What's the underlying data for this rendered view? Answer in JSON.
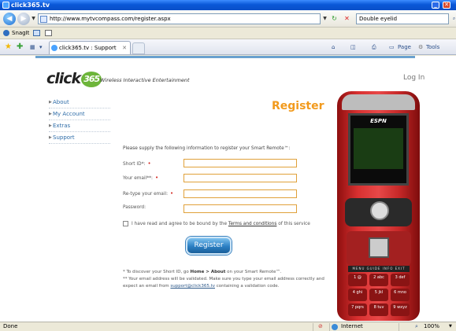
{
  "window": {
    "title": "click365.tv"
  },
  "toolbar": {
    "address_url": "http://www.mytvcompass.com/register.aspx",
    "search_value": "Double eyelid"
  },
  "snagit": {
    "label": "SnagIt"
  },
  "tabs": {
    "active_label": "click365.tv : Support"
  },
  "cmdbar": {
    "page_label": "Page",
    "tools_label": "Tools"
  },
  "site": {
    "brand_left": "click",
    "brand_badge": "365",
    "tagline": "Wireless Interactive Entertainment",
    "login_label": "Log In"
  },
  "menu": [
    {
      "label": "About"
    },
    {
      "label": "My Account"
    },
    {
      "label": "Extras"
    },
    {
      "label": "Support"
    }
  ],
  "form": {
    "title": "Register",
    "intro": "Please supply the following information to register your Smart Remote™:",
    "fields": [
      {
        "label": "Short ID*:",
        "required": true
      },
      {
        "label": "Your email**:",
        "required": true
      },
      {
        "label": "Re-type your email:",
        "required": true
      },
      {
        "label": "Password:",
        "required": false
      }
    ],
    "agree_prefix": "I have read and agree to be bound by the ",
    "agree_link": "Terms and conditions",
    "agree_suffix": " of this service",
    "submit_label": "Register",
    "note1_prefix": "* To discover your Short ID, go ",
    "note1_path": "Home > About",
    "note1_suffix": " on your Smart Remote™.",
    "note2": "** Your email address will be validated. Make sure you type your email address correctly and",
    "note3_prefix": "expect an email from ",
    "note3_email": "support@click365.tv",
    "note3_suffix": " containing a validation code."
  },
  "phone": {
    "screen_logo": "ESPN",
    "fn_row": "MENU GUIDE INFO EXIT",
    "keys": [
      "1 @",
      "2 abc",
      "3 def",
      "4 ghi",
      "5 jkl",
      "6 mno",
      "7 pqrs",
      "8 tuv",
      "9 wxyz"
    ]
  },
  "statusbar": {
    "status_text": "Done",
    "zone_label": "Internet",
    "zoom_label": "100%"
  }
}
